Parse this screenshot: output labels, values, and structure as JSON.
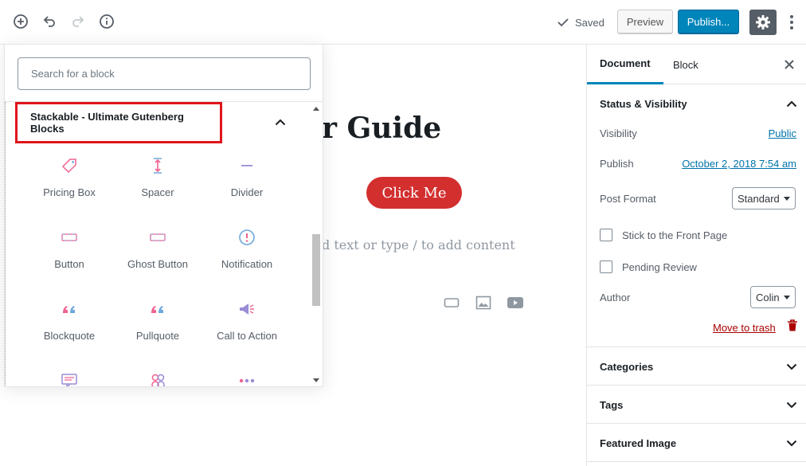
{
  "toolbar": {
    "add_block_icon": "plus-circle-icon",
    "undo_icon": "undo-icon",
    "redo_icon": "redo-icon",
    "info_icon": "info-icon",
    "saved_label": "Saved",
    "preview_label": "Preview",
    "publish_label": "Publish...",
    "settings_icon": "gear-icon",
    "more_icon": "more-vertical-icon"
  },
  "editor": {
    "title_fragment": "r Guide",
    "button_label": "Click Me",
    "placeholder_fragment": "d text or type / to add content"
  },
  "inserter": {
    "search_placeholder": "Search for a block",
    "panel_title": "Stackable - Ultimate Gutenberg Blocks",
    "blocks": [
      {
        "label": "Pricing Box",
        "icon": "price-tag-icon"
      },
      {
        "label": "Spacer",
        "icon": "spacer-icon"
      },
      {
        "label": "Divider",
        "icon": "divider-icon"
      },
      {
        "label": "Button",
        "icon": "button-icon"
      },
      {
        "label": "Ghost Button",
        "icon": "ghost-button-icon"
      },
      {
        "label": "Notification",
        "icon": "notification-icon"
      },
      {
        "label": "Blockquote",
        "icon": "blockquote-icon"
      },
      {
        "label": "Pullquote",
        "icon": "pullquote-icon"
      },
      {
        "label": "Call to Action",
        "icon": "megaphone-icon"
      },
      {
        "label": "",
        "icon": "testimonial-icon"
      },
      {
        "label": "",
        "icon": "team-member-icon"
      },
      {
        "label": "",
        "icon": "more-dots-icon"
      }
    ]
  },
  "sidebar": {
    "tabs": [
      {
        "label": "Document",
        "active": true
      },
      {
        "label": "Block",
        "active": false
      }
    ],
    "status_panel": {
      "title": "Status & Visibility",
      "visibility_label": "Visibility",
      "visibility_value": "Public",
      "publish_label": "Publish",
      "publish_value": "October 2, 2018 7:54 am",
      "post_format_label": "Post Format",
      "post_format_value": "Standard",
      "sticky_label": "Stick to the Front Page",
      "pending_label": "Pending Review",
      "author_label": "Author",
      "author_value": "Colin",
      "trash_label": "Move to trash"
    },
    "panels": [
      {
        "title": "Categories"
      },
      {
        "title": "Tags"
      },
      {
        "title": "Featured Image"
      }
    ]
  },
  "colors": {
    "accent": "#0085ba",
    "highlight_border": "#e0151b",
    "cta_button": "#d32f2f",
    "trash": "#aa0000"
  }
}
